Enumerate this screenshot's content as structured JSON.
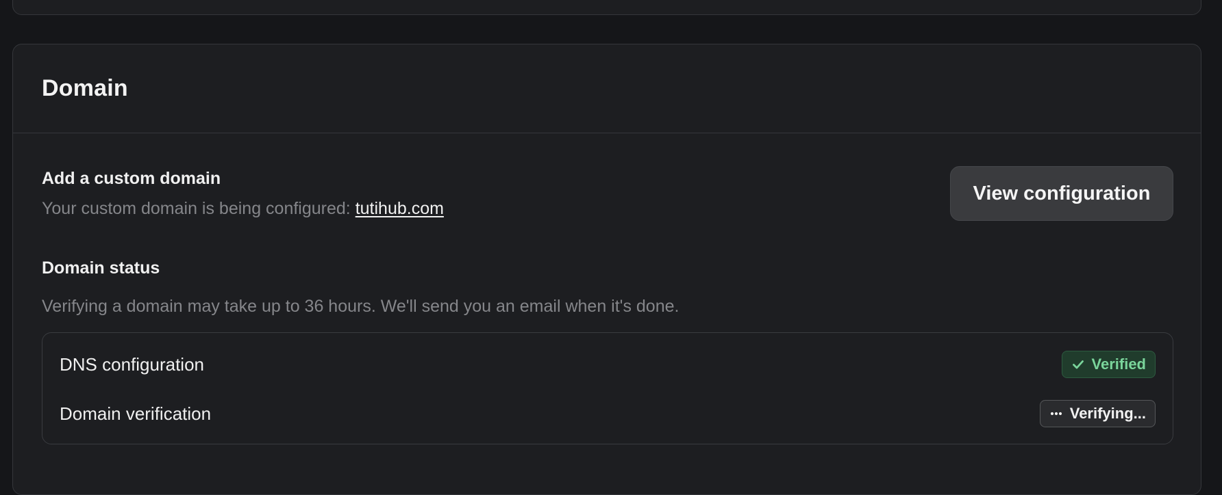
{
  "domain_card": {
    "title": "Domain",
    "custom_domain": {
      "title": "Add a custom domain",
      "description_prefix": "Your custom domain is being configured: ",
      "domain": "tutihub.com",
      "button_label": "View configuration"
    },
    "domain_status": {
      "title": "Domain status",
      "description": "Verifying a domain may take up to 36 hours. We'll send you an email when it's done.",
      "items": [
        {
          "label": "DNS configuration",
          "status": "Verified",
          "icon": "check-icon",
          "color": "#7ad59b"
        },
        {
          "label": "Domain verification",
          "status": "Verifying...",
          "icon": "dots-icon",
          "color": "#f2f2f2"
        }
      ]
    }
  }
}
